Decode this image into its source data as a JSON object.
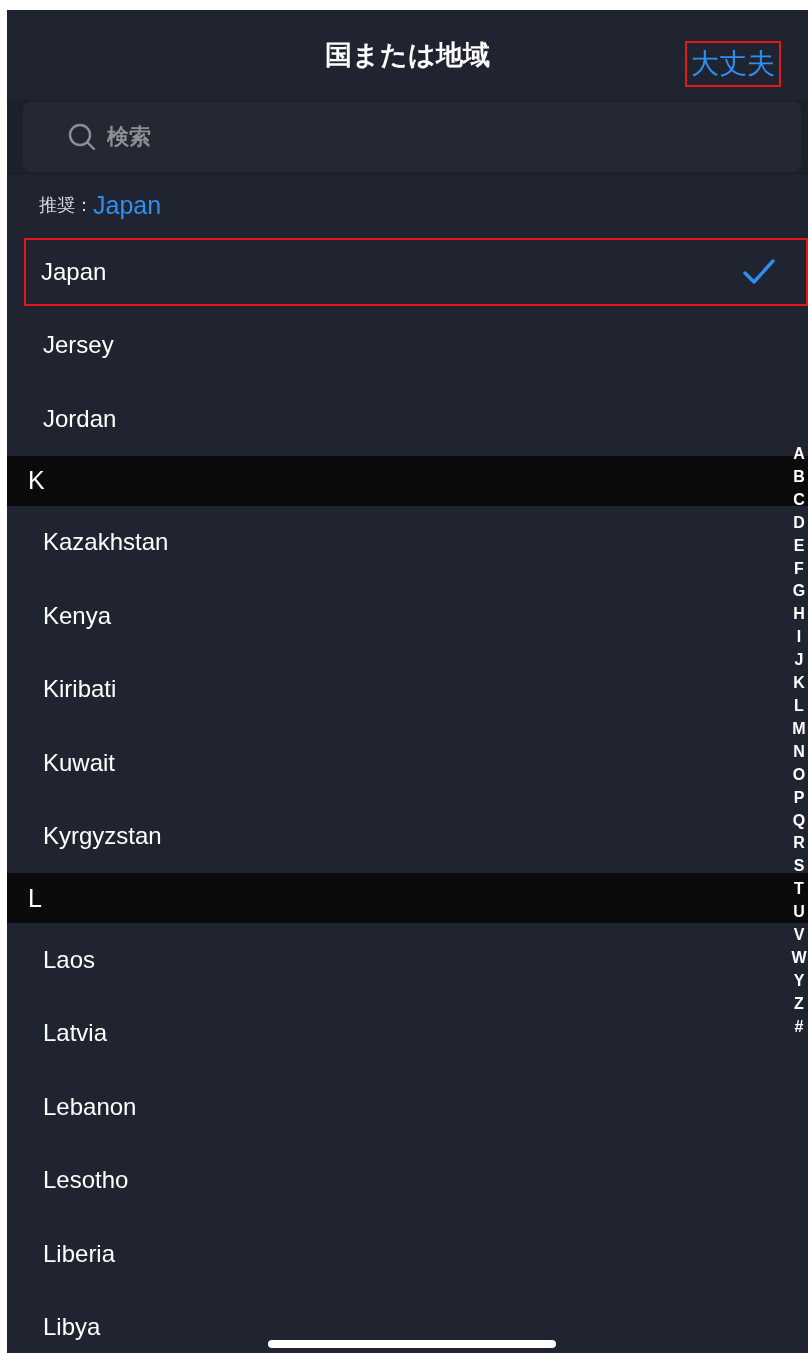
{
  "nav_bar": {
    "title": "国または地域",
    "done_button": {
      "label": "大丈夫",
      "highlighted": true
    }
  },
  "search": {
    "placeholder": "検索"
  },
  "suggestion": {
    "label": "推奨：",
    "value": "Japan"
  },
  "sections": [
    {
      "rows": [
        {
          "name": "Japan",
          "selected": true,
          "highlighted": true
        },
        {
          "name": "Jersey",
          "selected": false,
          "highlighted": false
        },
        {
          "name": "Jordan",
          "selected": false,
          "highlighted": false
        }
      ]
    },
    {
      "letter": "K",
      "rows": [
        {
          "name": "Kazakhstan",
          "selected": false,
          "highlighted": false
        },
        {
          "name": "Kenya",
          "selected": false,
          "highlighted": false
        },
        {
          "name": "Kiribati",
          "selected": false,
          "highlighted": false
        },
        {
          "name": "Kuwait",
          "selected": false,
          "highlighted": false
        },
        {
          "name": "Kyrgyzstan",
          "selected": false,
          "highlighted": false
        }
      ]
    },
    {
      "letter": "L",
      "rows": [
        {
          "name": "Laos",
          "selected": false,
          "highlighted": false
        },
        {
          "name": "Latvia",
          "selected": false,
          "highlighted": false
        },
        {
          "name": "Lebanon",
          "selected": false,
          "highlighted": false
        },
        {
          "name": "Lesotho",
          "selected": false,
          "highlighted": false
        },
        {
          "name": "Liberia",
          "selected": false,
          "highlighted": false
        },
        {
          "name": "Libya",
          "selected": false,
          "highlighted": false
        }
      ]
    }
  ],
  "index": [
    "A",
    "B",
    "C",
    "D",
    "E",
    "F",
    "G",
    "H",
    "I",
    "J",
    "K",
    "L",
    "M",
    "N",
    "O",
    "P",
    "Q",
    "R",
    "S",
    "T",
    "U",
    "V",
    "W",
    "Y",
    "Z",
    "#"
  ]
}
